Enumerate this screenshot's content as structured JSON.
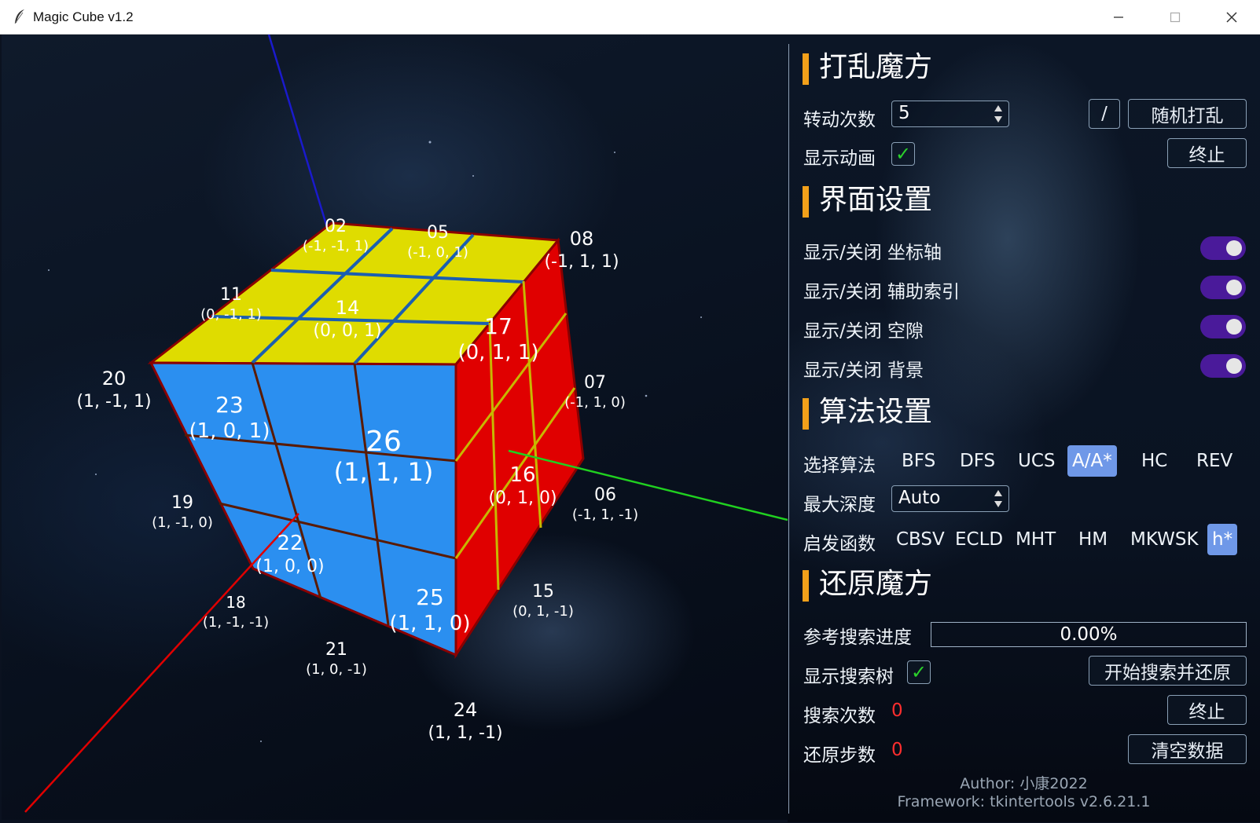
{
  "window": {
    "title": "Magic Cube v1.2",
    "controls": [
      "—",
      "☐",
      "✕"
    ]
  },
  "colors": {
    "accent_bar": "#f2a01a",
    "selected_option": "#6f98e8",
    "toggle_on": "#4a1a9a",
    "check_green": "#2bd12b",
    "error_red": "#ff2e2e",
    "cube_top": "#dfdc00",
    "cube_front": "#2b8ff0",
    "cube_right": "#e00000",
    "axis_x": "#e00000",
    "axis_y": "#20d020",
    "axis_z": "#1a1acc"
  },
  "cube_labels": [
    {
      "id": "02",
      "coord": "(-1, -1, 1)"
    },
    {
      "id": "05",
      "coord": "(-1, 0, 1)"
    },
    {
      "id": "08",
      "coord": "(-1, 1, 1)"
    },
    {
      "id": "11",
      "coord": "(0, -1, 1)"
    },
    {
      "id": "14",
      "coord": "(0, 0, 1)"
    },
    {
      "id": "17",
      "coord": "(0, 1, 1)"
    },
    {
      "id": "07",
      "coord": "(-1, 1, 0)"
    },
    {
      "id": "20",
      "coord": "(1, -1, 1)"
    },
    {
      "id": "23",
      "coord": "(1, 0, 1)"
    },
    {
      "id": "26",
      "coord": "(1, 1, 1)"
    },
    {
      "id": "16",
      "coord": "(0, 1, 0)"
    },
    {
      "id": "06",
      "coord": "(-1, 1, -1)"
    },
    {
      "id": "19",
      "coord": "(1, -1, 0)"
    },
    {
      "id": "22",
      "coord": "(1, 0, 0)"
    },
    {
      "id": "25",
      "coord": "(1, 1, 0)"
    },
    {
      "id": "15",
      "coord": "(0, 1, -1)"
    },
    {
      "id": "18",
      "coord": "(1, -1, -1)"
    },
    {
      "id": "21",
      "coord": "(1, 0, -1)"
    },
    {
      "id": "24",
      "coord": "(1, 1, -1)"
    }
  ],
  "scramble": {
    "title": "打乱魔方",
    "turns_label": "转动次数",
    "turns_value": "5",
    "slash_button": "/",
    "random_button": "随机打乱",
    "animation_label": "显示动画",
    "animation_checked": true,
    "stop_button": "终止"
  },
  "interface": {
    "title": "界面设置",
    "toggles": [
      {
        "label": "显示/关闭 坐标轴",
        "on": true
      },
      {
        "label": "显示/关闭 辅助索引",
        "on": true
      },
      {
        "label": "显示/关闭 空隙",
        "on": true
      },
      {
        "label": "显示/关闭 背景",
        "on": true
      }
    ]
  },
  "algorithm": {
    "title": "算法设置",
    "select_label": "选择算法",
    "options": [
      "BFS",
      "DFS",
      "UCS",
      "A/A*",
      "HC",
      "REV"
    ],
    "selected": "A/A*",
    "depth_label": "最大深度",
    "depth_value": "Auto",
    "heuristic_label": "启发函数",
    "heuristics": [
      "CBSV",
      "ECLD",
      "MHT",
      "HM",
      "MKWSK",
      "h*"
    ],
    "heuristic_selected": "h*"
  },
  "restore": {
    "title": "还原魔方",
    "progress_label": "参考搜索进度",
    "progress_text": "0.00%",
    "progress_fraction": 0.0,
    "tree_label": "显示搜索树",
    "tree_checked": true,
    "start_button": "开始搜索并还原",
    "search_count_label": "搜索次数",
    "search_count": "0",
    "stop_button": "终止",
    "steps_label": "还原步数",
    "steps": "0",
    "clear_button": "清空数据"
  },
  "footer": {
    "author": "Author: 小康2022",
    "framework": "Framework: tkintertools v2.6.21.1"
  }
}
